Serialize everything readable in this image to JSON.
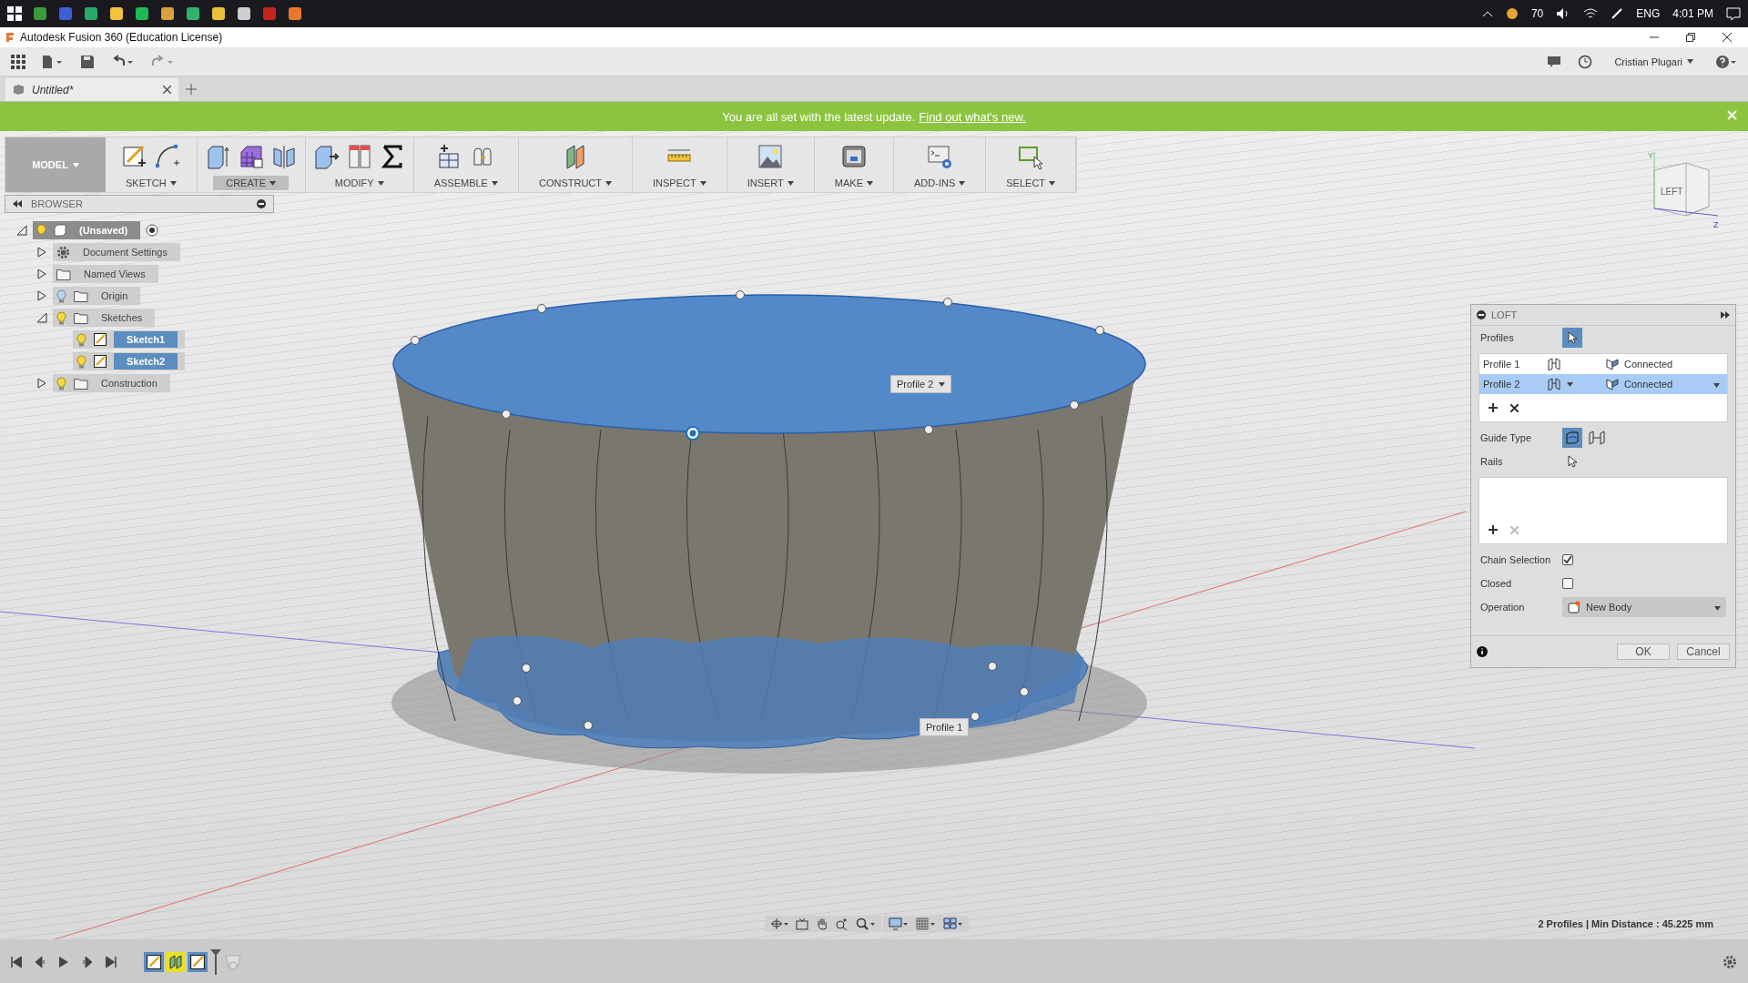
{
  "taskbar": {
    "apps": [
      {
        "kind": "start"
      },
      {
        "kind": "app",
        "color": "#3c9a3c"
      },
      {
        "kind": "app",
        "color": "#3d5fd6"
      },
      {
        "kind": "app",
        "color": "#2aa86a"
      },
      {
        "kind": "app",
        "color": "#f2c23a"
      },
      {
        "kind": "app",
        "color": "#1db954"
      },
      {
        "kind": "app",
        "color": "#d9a13b"
      },
      {
        "kind": "app",
        "color": "#2fb36b"
      },
      {
        "kind": "app",
        "color": "#e8c23a"
      },
      {
        "kind": "app",
        "color": "#cfcfcf"
      },
      {
        "kind": "app",
        "color": "#c6241f"
      },
      {
        "kind": "app",
        "color": "#e8772e"
      }
    ],
    "tray": {
      "temperature": "70",
      "language": "ENG",
      "time": "4:01 PM"
    }
  },
  "window": {
    "title": "Autodesk Fusion 360 (Education License)"
  },
  "app_bar": {
    "user": "Cristian Plugari"
  },
  "tabs": [
    {
      "label": "Untitled*",
      "selected": true
    }
  ],
  "banner": {
    "text": "You are all set with the latest update.",
    "link": "Find out what's new."
  },
  "toolbar": {
    "workspace": "MODEL",
    "groups": [
      {
        "label": "SKETCH",
        "kind": "sketch",
        "selected": false
      },
      {
        "label": "CREATE",
        "kind": "create",
        "selected": true
      },
      {
        "label": "MODIFY",
        "kind": "modify",
        "selected": false
      },
      {
        "label": "ASSEMBLE",
        "kind": "assemble",
        "selected": false
      },
      {
        "label": "CONSTRUCT",
        "kind": "construct",
        "selected": false
      },
      {
        "label": "INSPECT",
        "kind": "inspect",
        "selected": false
      },
      {
        "label": "INSERT",
        "kind": "insert",
        "selected": false
      },
      {
        "label": "MAKE",
        "kind": "make",
        "selected": false
      },
      {
        "label": "ADD-INS",
        "kind": "addins",
        "selected": false
      },
      {
        "label": "SELECT",
        "kind": "select",
        "selected": false
      }
    ]
  },
  "browser": {
    "title": "BROWSER",
    "tree": [
      {
        "label": "(Unsaved)",
        "kind": "component",
        "expanded": true,
        "visible": true,
        "selected": false,
        "children": [
          {
            "label": "Document Settings",
            "kind": "settings",
            "expanded": false,
            "selected": false
          },
          {
            "label": "Named Views",
            "kind": "folder",
            "expanded": false,
            "selected": false
          },
          {
            "label": "Origin",
            "kind": "folder",
            "expanded": false,
            "visible": false,
            "selected": false
          },
          {
            "label": "Sketches",
            "kind": "folder",
            "expanded": true,
            "visible": true,
            "selected": false,
            "children": [
              {
                "label": "Sketch1",
                "kind": "sketch",
                "visible": true,
                "selected": true
              },
              {
                "label": "Sketch2",
                "kind": "sketch",
                "visible": true,
                "selected": true
              }
            ]
          },
          {
            "label": "Construction",
            "kind": "folder",
            "expanded": false,
            "visible": true,
            "selected": false
          }
        ]
      }
    ]
  },
  "viewport": {
    "profile_tags": [
      {
        "label": "Profile 2"
      },
      {
        "label": "Profile 1"
      }
    ],
    "viewcube": {
      "face": "LEFT",
      "axes": [
        "Y",
        "Z"
      ]
    },
    "status": "2 Profiles | Min Distance : 45.225 mm"
  },
  "loft": {
    "title": "LOFT",
    "profiles_label": "Profiles",
    "profiles": [
      {
        "name": "Profile 1",
        "continuity": "Connected",
        "selected": false
      },
      {
        "name": "Profile 2",
        "continuity": "Connected",
        "selected": true
      }
    ],
    "guide_type_label": "Guide Type",
    "rails_label": "Rails",
    "options": [
      {
        "label": "Chain Selection",
        "checked": true
      },
      {
        "label": "Closed",
        "checked": false
      }
    ],
    "operation_label": "Operation",
    "operation": "New Body",
    "buttons": [
      "OK",
      "Cancel"
    ]
  },
  "timeline": {
    "features": [
      {
        "kind": "sketch",
        "selected": false
      },
      {
        "kind": "construct",
        "selected": true
      },
      {
        "kind": "sketch",
        "selected": false
      }
    ]
  }
}
